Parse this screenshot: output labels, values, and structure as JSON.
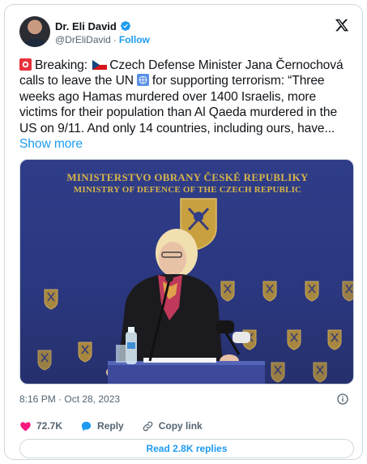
{
  "author": {
    "name": "Dr. Eli David",
    "handle": "@DrEliDavid",
    "separator": "·",
    "follow_label": "Follow"
  },
  "tweet": {
    "text_1": "Breaking:",
    "text_2": "Czech Defense Minister Jana Černochová calls to leave the UN",
    "text_3": "for supporting terrorism: “Three weeks ago Hamas murdered over 1400 Israelis, more victims for their population than Al Qaeda murdered in the US on 9/11. And only 14 countries, including ours, have...",
    "show_more": "Show more"
  },
  "photo": {
    "sign_line1": "MINISTERSTVO OBRANY ČESKÉ REPUBLIKY",
    "sign_line2": "MINISTRY OF DEFENCE OF THE CZECH REPUBLIC"
  },
  "meta": {
    "timestamp": "8:16 PM · Oct 28, 2023"
  },
  "actions": {
    "likes": "72.7K",
    "reply_label": "Reply",
    "copy_link_label": "Copy link",
    "read_replies": "Read 2.8K replies"
  },
  "colors": {
    "accent": "#1d9bf0",
    "like": "#f91880",
    "muted": "#536471"
  },
  "icons": [
    "verified-badge-icon",
    "x-logo-icon",
    "siren-emoji-icon",
    "czech-flag-icon",
    "un-emoji-icon",
    "info-icon",
    "heart-icon",
    "reply-bubble-icon",
    "link-icon"
  ]
}
